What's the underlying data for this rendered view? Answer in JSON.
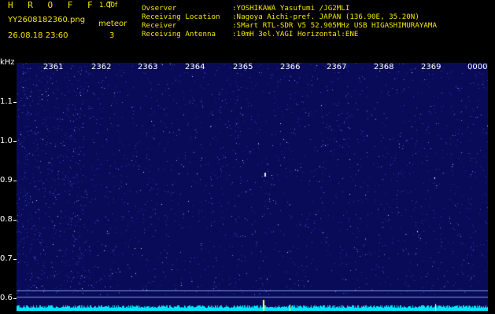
{
  "header": {
    "brand": "H R O F F T",
    "version": "1.00f",
    "filename": "YY2608182360.png",
    "detect_type": "meteor",
    "timestamp": "26.08.18 23:60",
    "count": "3"
  },
  "info": [
    {
      "label": "Ovserver",
      "value": ":YOSHIKAWA Yasufumi /JG2MLI"
    },
    {
      "label": "Receiving Location",
      "value": ":Nagoya Aichi-pref. JAPAN (136.90E, 35.20N)"
    },
    {
      "label": "Receiver",
      "value": ":SMart RTL-SDR V5 52.905MHz USB HIGASHIMURAYAMA"
    },
    {
      "label": "Receiving Antenna",
      "value": ":10mH 3el.YAGI Horizontal:ENE"
    }
  ],
  "axis": {
    "y_unit": "kHz",
    "y_ticks": [
      "1.1",
      "1.0",
      "0.9",
      "0.8",
      "0.7",
      "0.6"
    ],
    "x_ticks": [
      "2361",
      "2362",
      "2363",
      "2364",
      "2365",
      "2366",
      "2367",
      "2368",
      "2369",
      "0000"
    ]
  },
  "colors": {
    "label_yellow": "#f5e600",
    "background": "#0a0b58",
    "noise": "#3b63ff",
    "trace": "#00e5ff"
  }
}
